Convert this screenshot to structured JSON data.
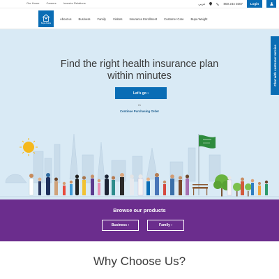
{
  "topbar": {
    "links": [
      "Our Home",
      "Careers",
      "Investor Relations"
    ],
    "language": "عربي",
    "phone": "800 244 0307",
    "login": "Login"
  },
  "nav": {
    "logo_text": "Bupa Arabia",
    "links": [
      "About us",
      "Business",
      "Family",
      "Visitors",
      "Insurance Enrollment",
      "Customer Care",
      "Bupa Weight"
    ]
  },
  "hero": {
    "title_line1": "Find the right health insurance plan",
    "title_line2": "within minutes",
    "cta": "Let's go  ›",
    "or": "Or",
    "continue": "Continue Purchasing Order"
  },
  "chat": {
    "label": "Chat with customer service"
  },
  "products": {
    "title": "Browse our products",
    "business": "Business  ›",
    "family": "Family  ›"
  },
  "why": {
    "title": "Why Choose Us?"
  },
  "colors": {
    "brand_blue": "#0a6db5",
    "hero_bg": "#d9eaf5",
    "products_bg": "#6b2d8d",
    "sun": "#f5b81c",
    "flag": "#2e8b3d"
  },
  "icons": [
    "home-icon",
    "location-pin-icon",
    "phone-icon",
    "user-icon",
    "sun-icon",
    "flag-icon",
    "chevron-right-icon"
  ]
}
